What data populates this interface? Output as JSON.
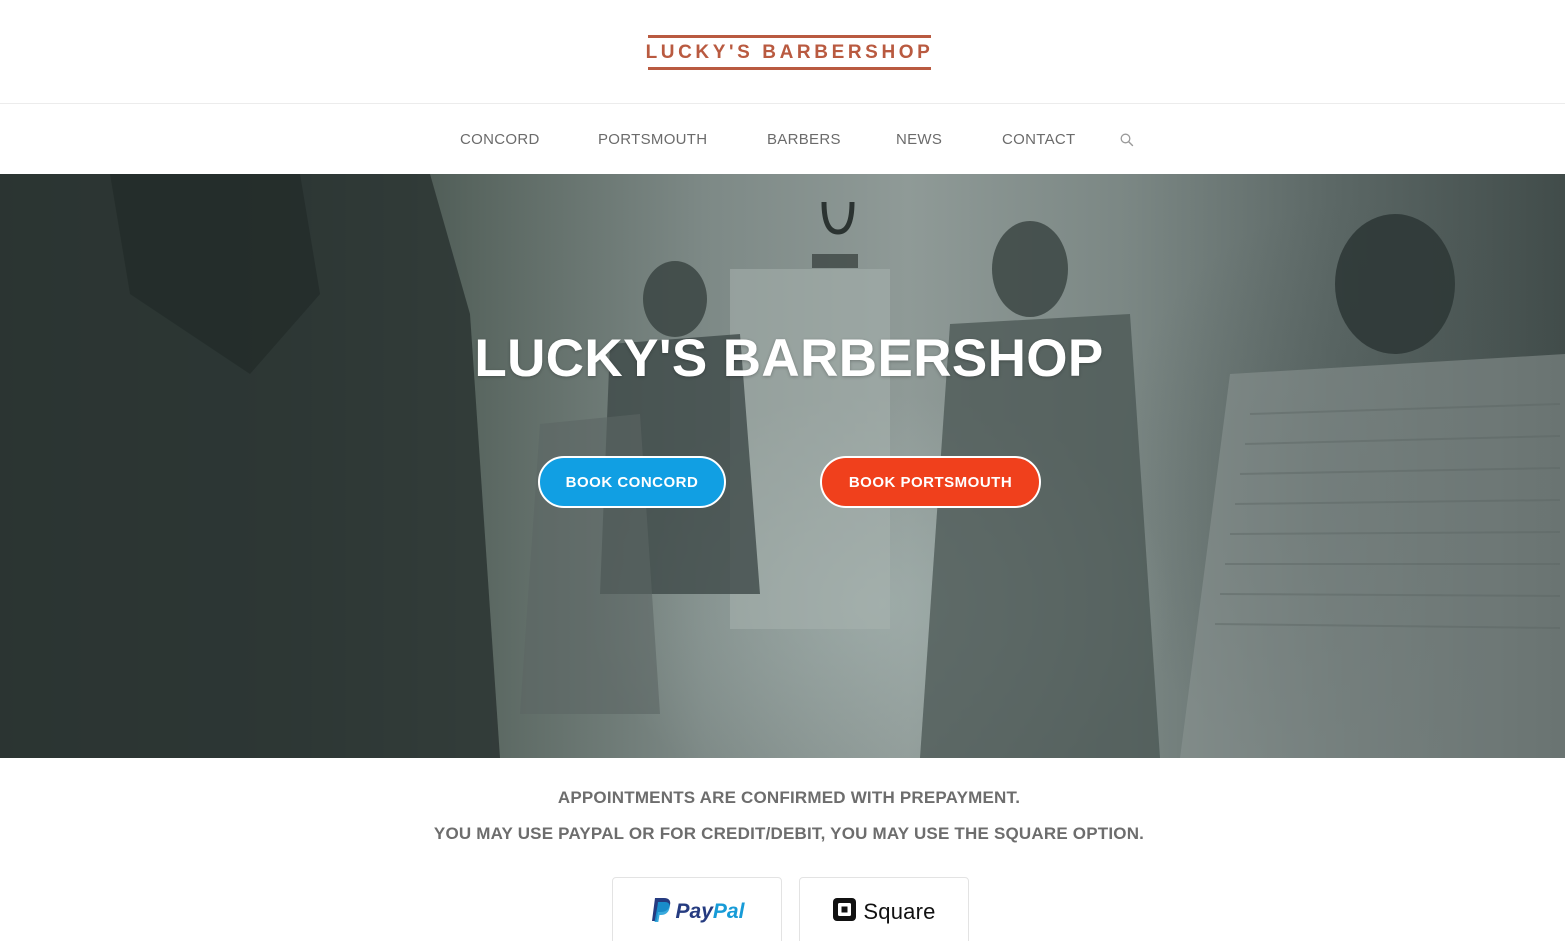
{
  "header": {
    "logo_text": "LUCKY'S BARBERSHOP",
    "logo_color": "#b95a40"
  },
  "nav": {
    "items": [
      {
        "label": "CONCORD"
      },
      {
        "label": "PORTSMOUTH"
      },
      {
        "label": "BARBERS"
      },
      {
        "label": "NEWS"
      },
      {
        "label": "CONTACT"
      }
    ],
    "search_icon": "search-icon"
  },
  "hero": {
    "title": "LUCKY'S BARBERSHOP",
    "book_concord_label": "BOOK CONCORD",
    "book_portsmouth_label": "BOOK PORTSMOUTH",
    "book_concord_color": "#119fe3",
    "book_portsmouth_color": "#f0401c",
    "background": "barbershop-interior-photo"
  },
  "info": {
    "line1": "APPOINTMENTS ARE CONFIRMED WITH PREPAYMENT.",
    "line2": "YOU MAY USE PAYPAL OR FOR CREDIT/DEBIT, YOU MAY USE THE SQUARE OPTION."
  },
  "payments": {
    "paypal": {
      "label_pay": "Pay",
      "label_pal": "Pal",
      "icon": "paypal-logo-icon"
    },
    "square": {
      "label": "Square",
      "icon": "square-logo-icon"
    }
  }
}
